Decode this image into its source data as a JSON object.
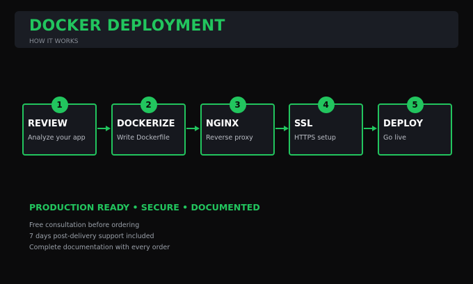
{
  "header": {
    "title": "DOCKER DEPLOYMENT",
    "subtitle": "HOW IT WORKS"
  },
  "steps": [
    {
      "number": "1",
      "title": "REVIEW",
      "description": "Analyze your app"
    },
    {
      "number": "2",
      "title": "DOCKERIZE",
      "description": "Write Dockerfile"
    },
    {
      "number": "3",
      "title": "NGINX",
      "description": "Reverse proxy"
    },
    {
      "number": "4",
      "title": "SSL",
      "description": "HTTPS setup"
    },
    {
      "number": "5",
      "title": "DEPLOY",
      "description": "Go live"
    }
  ],
  "footer": {
    "tagline": "PRODUCTION READY • SECURE • DOCUMENTED",
    "notes": [
      "Free consultation before ordering",
      "7 days post-delivery support included",
      "Complete documentation with every order"
    ]
  },
  "colors": {
    "accent": "#22c55e",
    "background": "#0b0b0c",
    "panel": "#1a1d24",
    "card": "#16181e"
  },
  "icons": {
    "connector": "arrow-right-icon"
  }
}
